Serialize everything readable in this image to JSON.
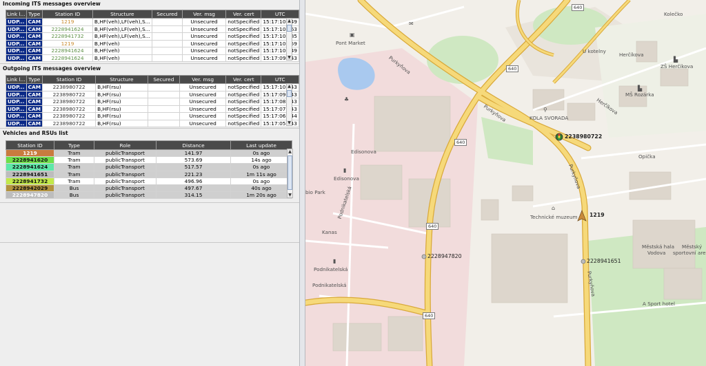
{
  "incoming": {
    "title": "Incoming ITS messages overview",
    "headers": [
      "Link l...",
      "Type",
      "Station ID",
      "Structure",
      "Secured",
      "Ver. msg",
      "Ver. cert",
      "UTC"
    ],
    "rows": [
      {
        "link": "UDP...",
        "type": "CAM",
        "station": "1219",
        "structure": "B,HF(veh),LF(veh),S...",
        "secured": "",
        "ver_msg": "Unsecured",
        "ver_cert": "notSpecified",
        "utc": "15:17:10.849",
        "color": "orange"
      },
      {
        "link": "UDP...",
        "type": "CAM",
        "station": "2228941624",
        "structure": "B,HF(veh),LF(veh),S...",
        "secured": "",
        "ver_msg": "Unsecured",
        "ver_cert": "notSpecified",
        "utc": "15:17:10.763",
        "color": "green"
      },
      {
        "link": "UDP...",
        "type": "CAM",
        "station": "2228941732",
        "structure": "B,HF(veh),LF(veh),S...",
        "secured": "",
        "ver_msg": "Unsecured",
        "ver_cert": "notSpecified",
        "utc": "15:17:10.385",
        "color": "green"
      },
      {
        "link": "UDP...",
        "type": "CAM",
        "station": "1219",
        "structure": "B,HF(veh)",
        "secured": "",
        "ver_msg": "Unsecured",
        "ver_cert": "notSpecified",
        "utc": "15:17:10.259",
        "color": "orange"
      },
      {
        "link": "UDP...",
        "type": "CAM",
        "station": "2228941624",
        "structure": "B,HF(veh)",
        "secured": "",
        "ver_msg": "Unsecured",
        "ver_cert": "notSpecified",
        "utc": "15:17:10.049",
        "color": "green"
      },
      {
        "link": "UDP...",
        "type": "CAM",
        "station": "2228941624",
        "structure": "B,HF(veh)",
        "secured": "",
        "ver_msg": "Unsecured",
        "ver_cert": "notSpecified",
        "utc": "15:17:09.943",
        "color": "green"
      }
    ]
  },
  "outgoing": {
    "title": "Outgoing ITS messages overview",
    "headers": [
      "Link l...",
      "Type",
      "Station ID",
      "Structure",
      "Secured",
      "Ver. msg",
      "Ver. cert",
      "UTC"
    ],
    "rows": [
      {
        "link": "UDP...",
        "type": "CAM",
        "station": "2238980722",
        "structure": "B,HF(rsu)",
        "secured": "",
        "ver_msg": "Unsecured",
        "ver_cert": "notSpecified",
        "utc": "15:17:10.543",
        "color": "plain"
      },
      {
        "link": "UDP...",
        "type": "CAM",
        "station": "2238980722",
        "structure": "B,HF(rsu)",
        "secured": "",
        "ver_msg": "Unsecured",
        "ver_cert": "notSpecified",
        "utc": "15:17:09.543",
        "color": "plain"
      },
      {
        "link": "UDP...",
        "type": "CAM",
        "station": "2238980722",
        "structure": "B,HF(rsu)",
        "secured": "",
        "ver_msg": "Unsecured",
        "ver_cert": "notSpecified",
        "utc": "15:17:08.543",
        "color": "plain"
      },
      {
        "link": "UDP...",
        "type": "CAM",
        "station": "2238980722",
        "structure": "B,HF(rsu)",
        "secured": "",
        "ver_msg": "Unsecured",
        "ver_cert": "notSpecified",
        "utc": "15:17:07.543",
        "color": "plain"
      },
      {
        "link": "UDP...",
        "type": "CAM",
        "station": "2238980722",
        "structure": "B,HF(rsu)",
        "secured": "",
        "ver_msg": "Unsecured",
        "ver_cert": "notSpecified",
        "utc": "15:17:06.544",
        "color": "plain"
      },
      {
        "link": "UDP...",
        "type": "CAM",
        "station": "2238980722",
        "structure": "B,HF(rsu)",
        "secured": "",
        "ver_msg": "Unsecured",
        "ver_cert": "notSpecified",
        "utc": "15:17:05.543",
        "color": "plain"
      }
    ]
  },
  "vehicles": {
    "title": "Vehicles and RSUs list",
    "headers": [
      "Station ID",
      "Type",
      "Role",
      "Distance",
      "Last update"
    ],
    "rows": [
      {
        "id": "1219",
        "type": "Tram",
        "role": "publicTransport",
        "distance": "141.97",
        "last": "0s ago",
        "color": "#c97b3e",
        "text_color": "#ffffff",
        "row_style": "gray"
      },
      {
        "id": "2228941620",
        "type": "Tram",
        "role": "publicTransport",
        "distance": "573.69",
        "last": "14s ago",
        "color": "#6fe04a",
        "text_color": "#111111",
        "row_style": "white"
      },
      {
        "id": "2228941624",
        "type": "Tram",
        "role": "publicTransport",
        "distance": "517.57",
        "last": "0s ago",
        "color": "#5ee8a8",
        "text_color": "#111111",
        "row_style": "gray"
      },
      {
        "id": "2228941651",
        "type": "Tram",
        "role": "publicTransport",
        "distance": "221.23",
        "last": "1m 11s ago",
        "color": "#bdbdbd",
        "text_color": "#111111",
        "row_style": "gray"
      },
      {
        "id": "2228941732",
        "type": "Tram",
        "role": "publicTransport",
        "distance": "496.96",
        "last": "0s ago",
        "color": "#c2e94a",
        "text_color": "#111111",
        "row_style": "white"
      },
      {
        "id": "2228942029",
        "type": "Bus",
        "role": "publicTransport",
        "distance": "497.67",
        "last": "40s ago",
        "color": "#b3933e",
        "text_color": "#111111",
        "row_style": "gray"
      },
      {
        "id": "2228947820",
        "type": "Bus",
        "role": "publicTransport",
        "distance": "314.15",
        "last": "1m 20s ago",
        "color": "#bdbdbd",
        "text_color": "#ffffff",
        "row_style": "gray"
      }
    ]
  },
  "map": {
    "shields": [
      "640",
      "640",
      "640",
      "640",
      "640"
    ],
    "labels": {
      "kolecko": "Kolečko",
      "pont_market": "Pont Market",
      "u_kotelny": "U kotelny",
      "hercikova1": "Herčíkova",
      "zs_hercikova": "ZŠ Herčíkova",
      "purkynova1": "Purkyňova",
      "ms_rozarka": "MŠ Rozárka",
      "hercikova2": "Herčíkova",
      "kola_svorada": "KOLA SVORADA",
      "purkynova2": "Purkyňova",
      "edisonova1": "Edisonova",
      "opicka": "Opička",
      "edisonova2": "Edisonova",
      "bio_park": "bio Park",
      "purkynova3": "Purkyňova",
      "technicke_muzeum": "Technické muzeum",
      "podnikatelska1": "Podnikatelská",
      "kanas": "Kanas",
      "mestska_hala": "Městská hala",
      "vodova": "Vodova",
      "mestsky_areal": "Městský",
      "sportovni_areal": "sportovní areál",
      "podnikatelska2": "Podnikatelská",
      "podnikatelska3": "Podnikatelská",
      "purkynova4": "Purkyňova",
      "a_sport_hotel": "A Sport hotel"
    },
    "stations": {
      "rsu": "2238980722",
      "tram": "1219",
      "bus": "2228947820",
      "tram2": "2228941651"
    },
    "colors": {
      "road": "#f6d97a",
      "road_outline": "#d9a93a",
      "park": "#cfe8c2",
      "water": "#a9c9ef",
      "industrial": "#f2dcdc",
      "building": "#ddd6cc"
    }
  }
}
